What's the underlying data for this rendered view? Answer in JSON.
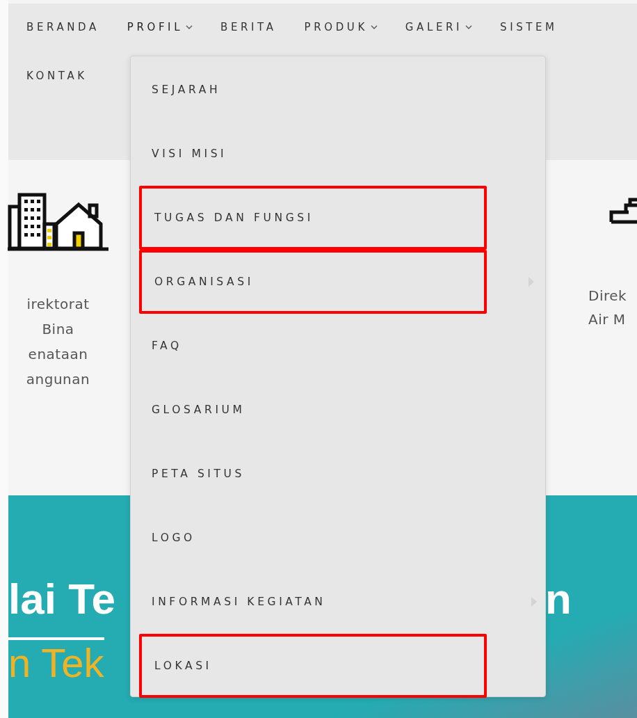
{
  "nav": {
    "items": [
      {
        "label": "BERANDA",
        "has_dropdown": false,
        "expanded": false
      },
      {
        "label": "PROFIL",
        "has_dropdown": true,
        "expanded": true
      },
      {
        "label": "BERITA",
        "has_dropdown": false,
        "expanded": false
      },
      {
        "label": "PRODUK",
        "has_dropdown": true,
        "expanded": false
      },
      {
        "label": "GALERI",
        "has_dropdown": true,
        "expanded": false
      },
      {
        "label": "SISTEM",
        "has_dropdown": false,
        "expanded": false
      },
      {
        "label": "KONTAK",
        "has_dropdown": false,
        "expanded": false
      }
    ]
  },
  "dropdown": {
    "items": [
      {
        "label": "SEJARAH",
        "has_submenu": false,
        "highlighted": false
      },
      {
        "label": "VISI MISI",
        "has_submenu": false,
        "highlighted": false
      },
      {
        "label": "TUGAS DAN FUNGSI",
        "has_submenu": false,
        "highlighted": true
      },
      {
        "label": "ORGANISASI",
        "has_submenu": true,
        "highlighted": true
      },
      {
        "label": "FAQ",
        "has_submenu": false,
        "highlighted": false
      },
      {
        "label": "GLOSARIUM",
        "has_submenu": false,
        "highlighted": false
      },
      {
        "label": "PETA SITUS",
        "has_submenu": false,
        "highlighted": false
      },
      {
        "label": "LOGO",
        "has_submenu": false,
        "highlighted": false
      },
      {
        "label": "INFORMASI KEGIATAN",
        "has_submenu": true,
        "highlighted": false
      },
      {
        "label": "LOKASI",
        "has_submenu": false,
        "highlighted": true
      }
    ]
  },
  "directorates": [
    {
      "name": "irektorat Bina enataan angunan"
    },
    {
      "name": "Direk Air M"
    }
  ],
  "banner": {
    "heading_left": "lai Te",
    "heading_right": "n",
    "subtitle": "n Tek"
  }
}
